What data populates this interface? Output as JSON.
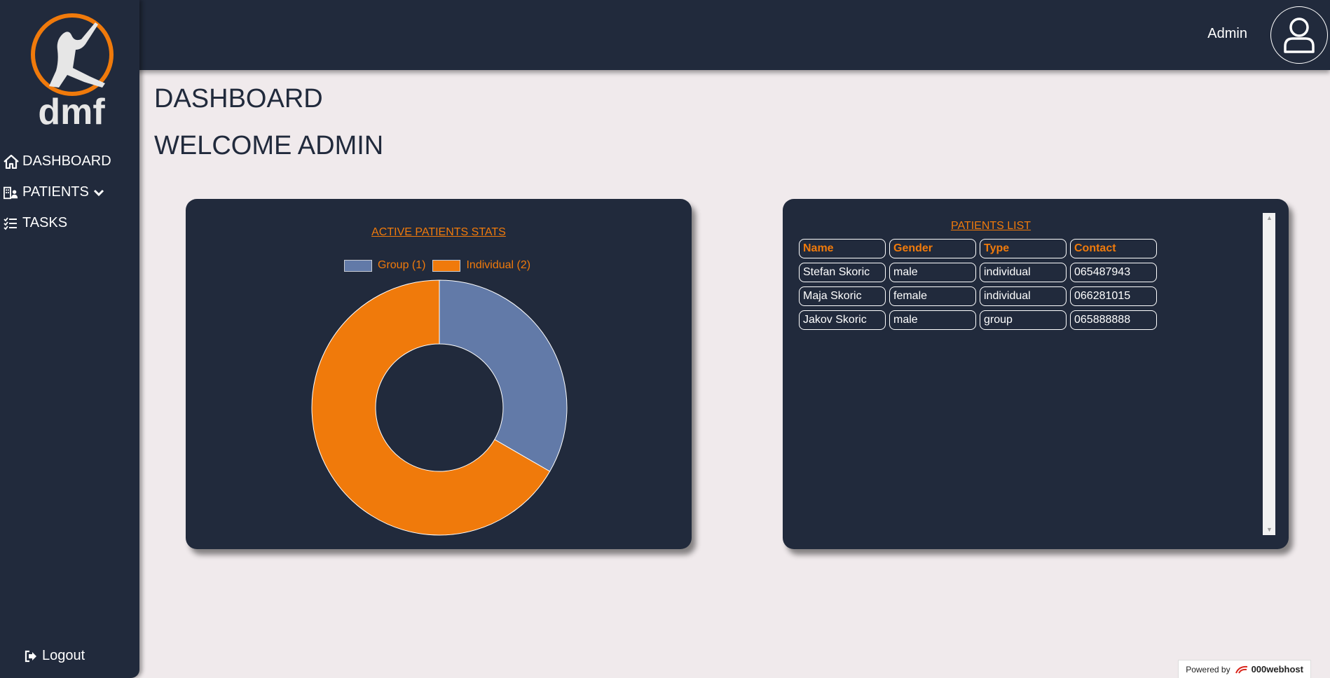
{
  "header": {
    "admin_name": "Admin"
  },
  "logo": {
    "text": "dmf"
  },
  "sidebar": {
    "items": [
      {
        "label": "DASHBOARD",
        "icon": "home-icon"
      },
      {
        "label": "PATIENTS",
        "icon": "patients-icon"
      },
      {
        "label": "TASKS",
        "icon": "tasks-icon"
      }
    ],
    "logout_label": "Logout"
  },
  "page": {
    "title": "DASHBOARD",
    "welcome": "WELCOME ADMIN"
  },
  "stats_card": {
    "title": "ACTIVE PATIENTS STATS",
    "legend": [
      {
        "label": "Group (1)",
        "color": "#627aa8"
      },
      {
        "label": "Individual (2)",
        "color": "#f07a0b"
      }
    ]
  },
  "chart_data": {
    "type": "pie",
    "title": "ACTIVE PATIENTS STATS",
    "categories": [
      "Group",
      "Individual"
    ],
    "values": [
      1,
      2
    ],
    "colors": [
      "#627aa8",
      "#f07a0b"
    ],
    "donut": true,
    "legend_position": "top"
  },
  "list_card": {
    "title": "PATIENTS LIST",
    "columns": [
      "Name",
      "Gender",
      "Type",
      "Contact"
    ],
    "rows": [
      [
        "Stefan Skoric",
        "male",
        "individual",
        "065487943"
      ],
      [
        "Maja Skoric",
        "female",
        "individual",
        "066281015"
      ],
      [
        "Jakov Skoric",
        "male",
        "group",
        "065888888"
      ]
    ]
  },
  "footer": {
    "powered_by": "Powered by",
    "brand": "000webhost"
  },
  "colors": {
    "sidebar_bg": "#212a3c",
    "accent": "#f07a0b",
    "page_bg": "#f0eaec",
    "group": "#627aa8"
  }
}
